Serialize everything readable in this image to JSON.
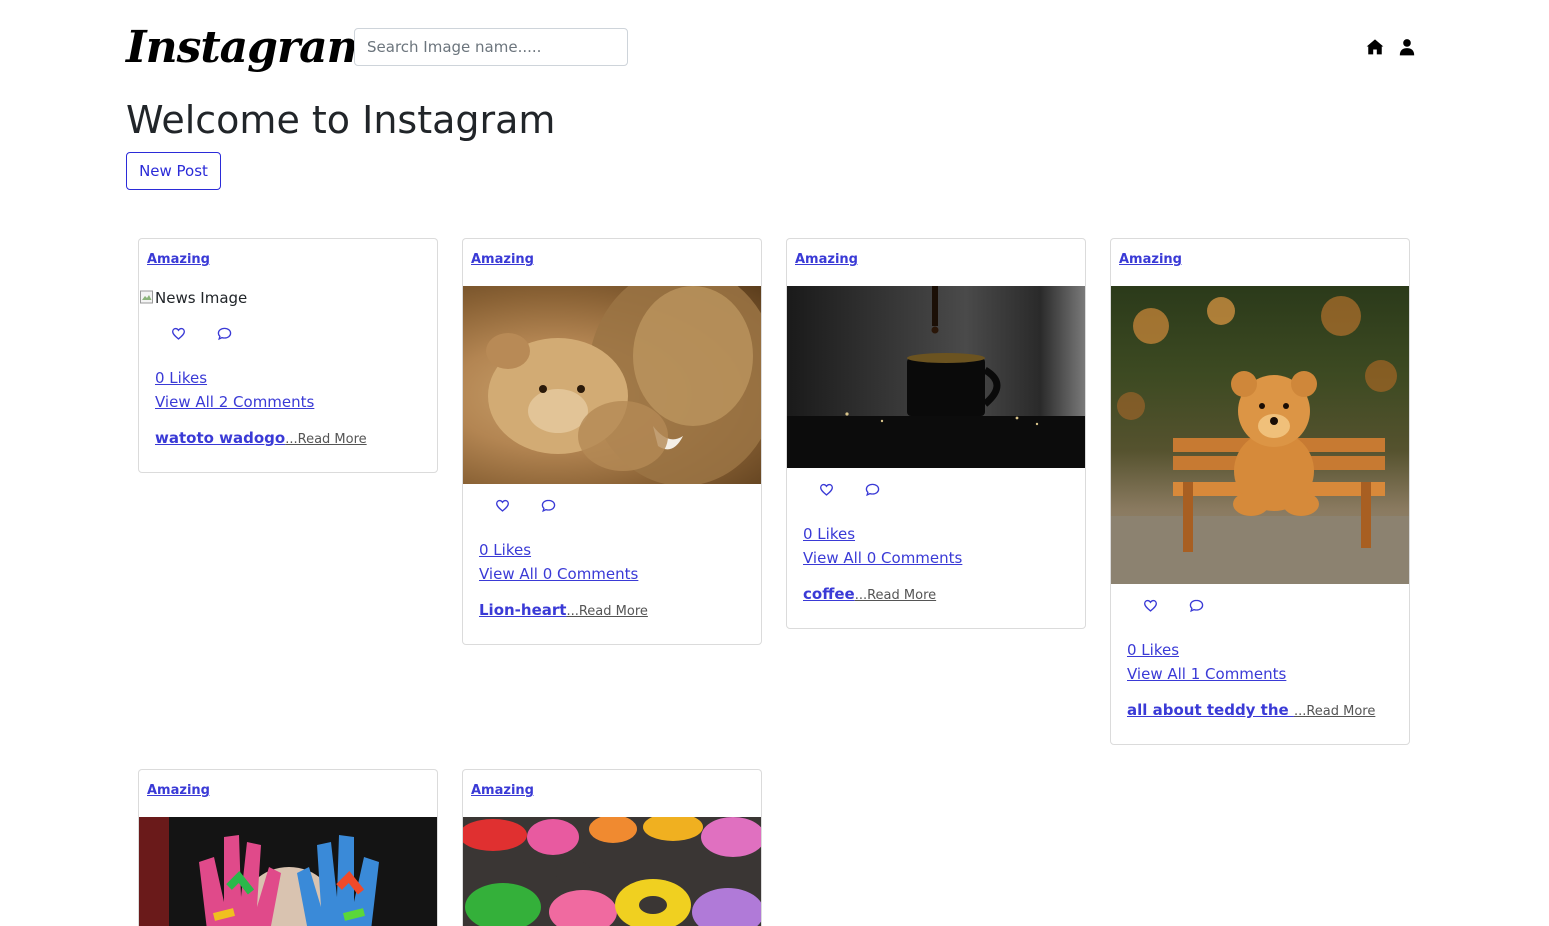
{
  "header": {
    "logo": "Instagram",
    "search_placeholder": "Search Image name.....",
    "home_icon": "home-icon",
    "user_icon": "user-icon"
  },
  "main": {
    "title": "Welcome to Instagram",
    "new_post_label": "New Post"
  },
  "accent": "#3a3ad6",
  "posts": [
    {
      "category": "Amazing",
      "image_alt": "News Image",
      "image": "broken",
      "likes": "0 Likes",
      "comments": "View All 2 Comments",
      "title": "watoto wadogo",
      "read_more": "...Read More"
    },
    {
      "category": "Amazing",
      "image": "lion",
      "likes": "0 Likes",
      "comments": "View All 0 Comments",
      "title": "Lion-heart",
      "read_more": "...Read More"
    },
    {
      "category": "Amazing",
      "image": "coffee",
      "likes": "0 Likes",
      "comments": "View All 0 Comments",
      "title": "coffee",
      "read_more": "...Read More"
    },
    {
      "category": "Amazing",
      "image": "teddy",
      "likes": "0 Likes",
      "comments": "View All 1 Comments",
      "title": "all about teddy the ",
      "read_more": "...Read More"
    },
    {
      "category": "Amazing",
      "image": "painted-hands"
    },
    {
      "category": "Amazing",
      "image": "colorful-letters"
    }
  ]
}
